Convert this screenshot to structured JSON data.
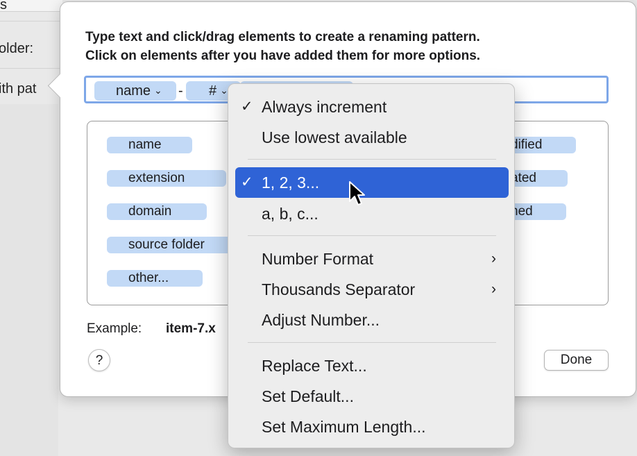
{
  "background": {
    "tab_fragment": "s",
    "folder_label_fragment": "older:",
    "with_pattern_fragment": "ith pat"
  },
  "popover": {
    "instructions_line1": "Type text and click/drag elements to create a renaming pattern.",
    "instructions_line2": "Click on elements after you have added them for more options.",
    "pattern_tokens": [
      {
        "label": "name",
        "has_chevron": true
      },
      {
        "separator": "-"
      },
      {
        "label": "#",
        "has_chevron": true
      },
      {
        "label": "",
        "partially_hidden": true
      }
    ],
    "elements_left": [
      "name",
      "extension",
      "domain",
      "source folder",
      "other..."
    ],
    "elements_right_fragments": [
      "dified",
      "ated",
      "ned"
    ],
    "example_label": "Example:",
    "example_value": "item-7.x",
    "help_label": "?",
    "done_label": "Done"
  },
  "menu": {
    "sections": [
      {
        "items": [
          {
            "label": "Always increment",
            "checked": true,
            "selected": false
          },
          {
            "label": "Use lowest available",
            "checked": false,
            "selected": false
          }
        ]
      },
      {
        "items": [
          {
            "label": "1, 2, 3...",
            "checked": true,
            "selected": true
          },
          {
            "label": "a, b, c...",
            "checked": false,
            "selected": false
          }
        ]
      },
      {
        "items": [
          {
            "label": "Number Format",
            "submenu": true
          },
          {
            "label": "Thousands Separator",
            "submenu": true
          },
          {
            "label": "Adjust Number..."
          }
        ]
      },
      {
        "items": [
          {
            "label": "Replace Text..."
          },
          {
            "label": "Set Default..."
          },
          {
            "label": "Set Maximum Length..."
          }
        ]
      }
    ],
    "check_glyph": "✓",
    "submenu_glyph": "›"
  },
  "colors": {
    "accent": "#2f63d6",
    "token_fill": "#c2d9f6",
    "focus_ring": "#7ea7e8"
  },
  "icons": {
    "help": "question-mark-icon",
    "chevron": "chevron-down-icon",
    "pointer": "mouse-pointer-icon"
  }
}
